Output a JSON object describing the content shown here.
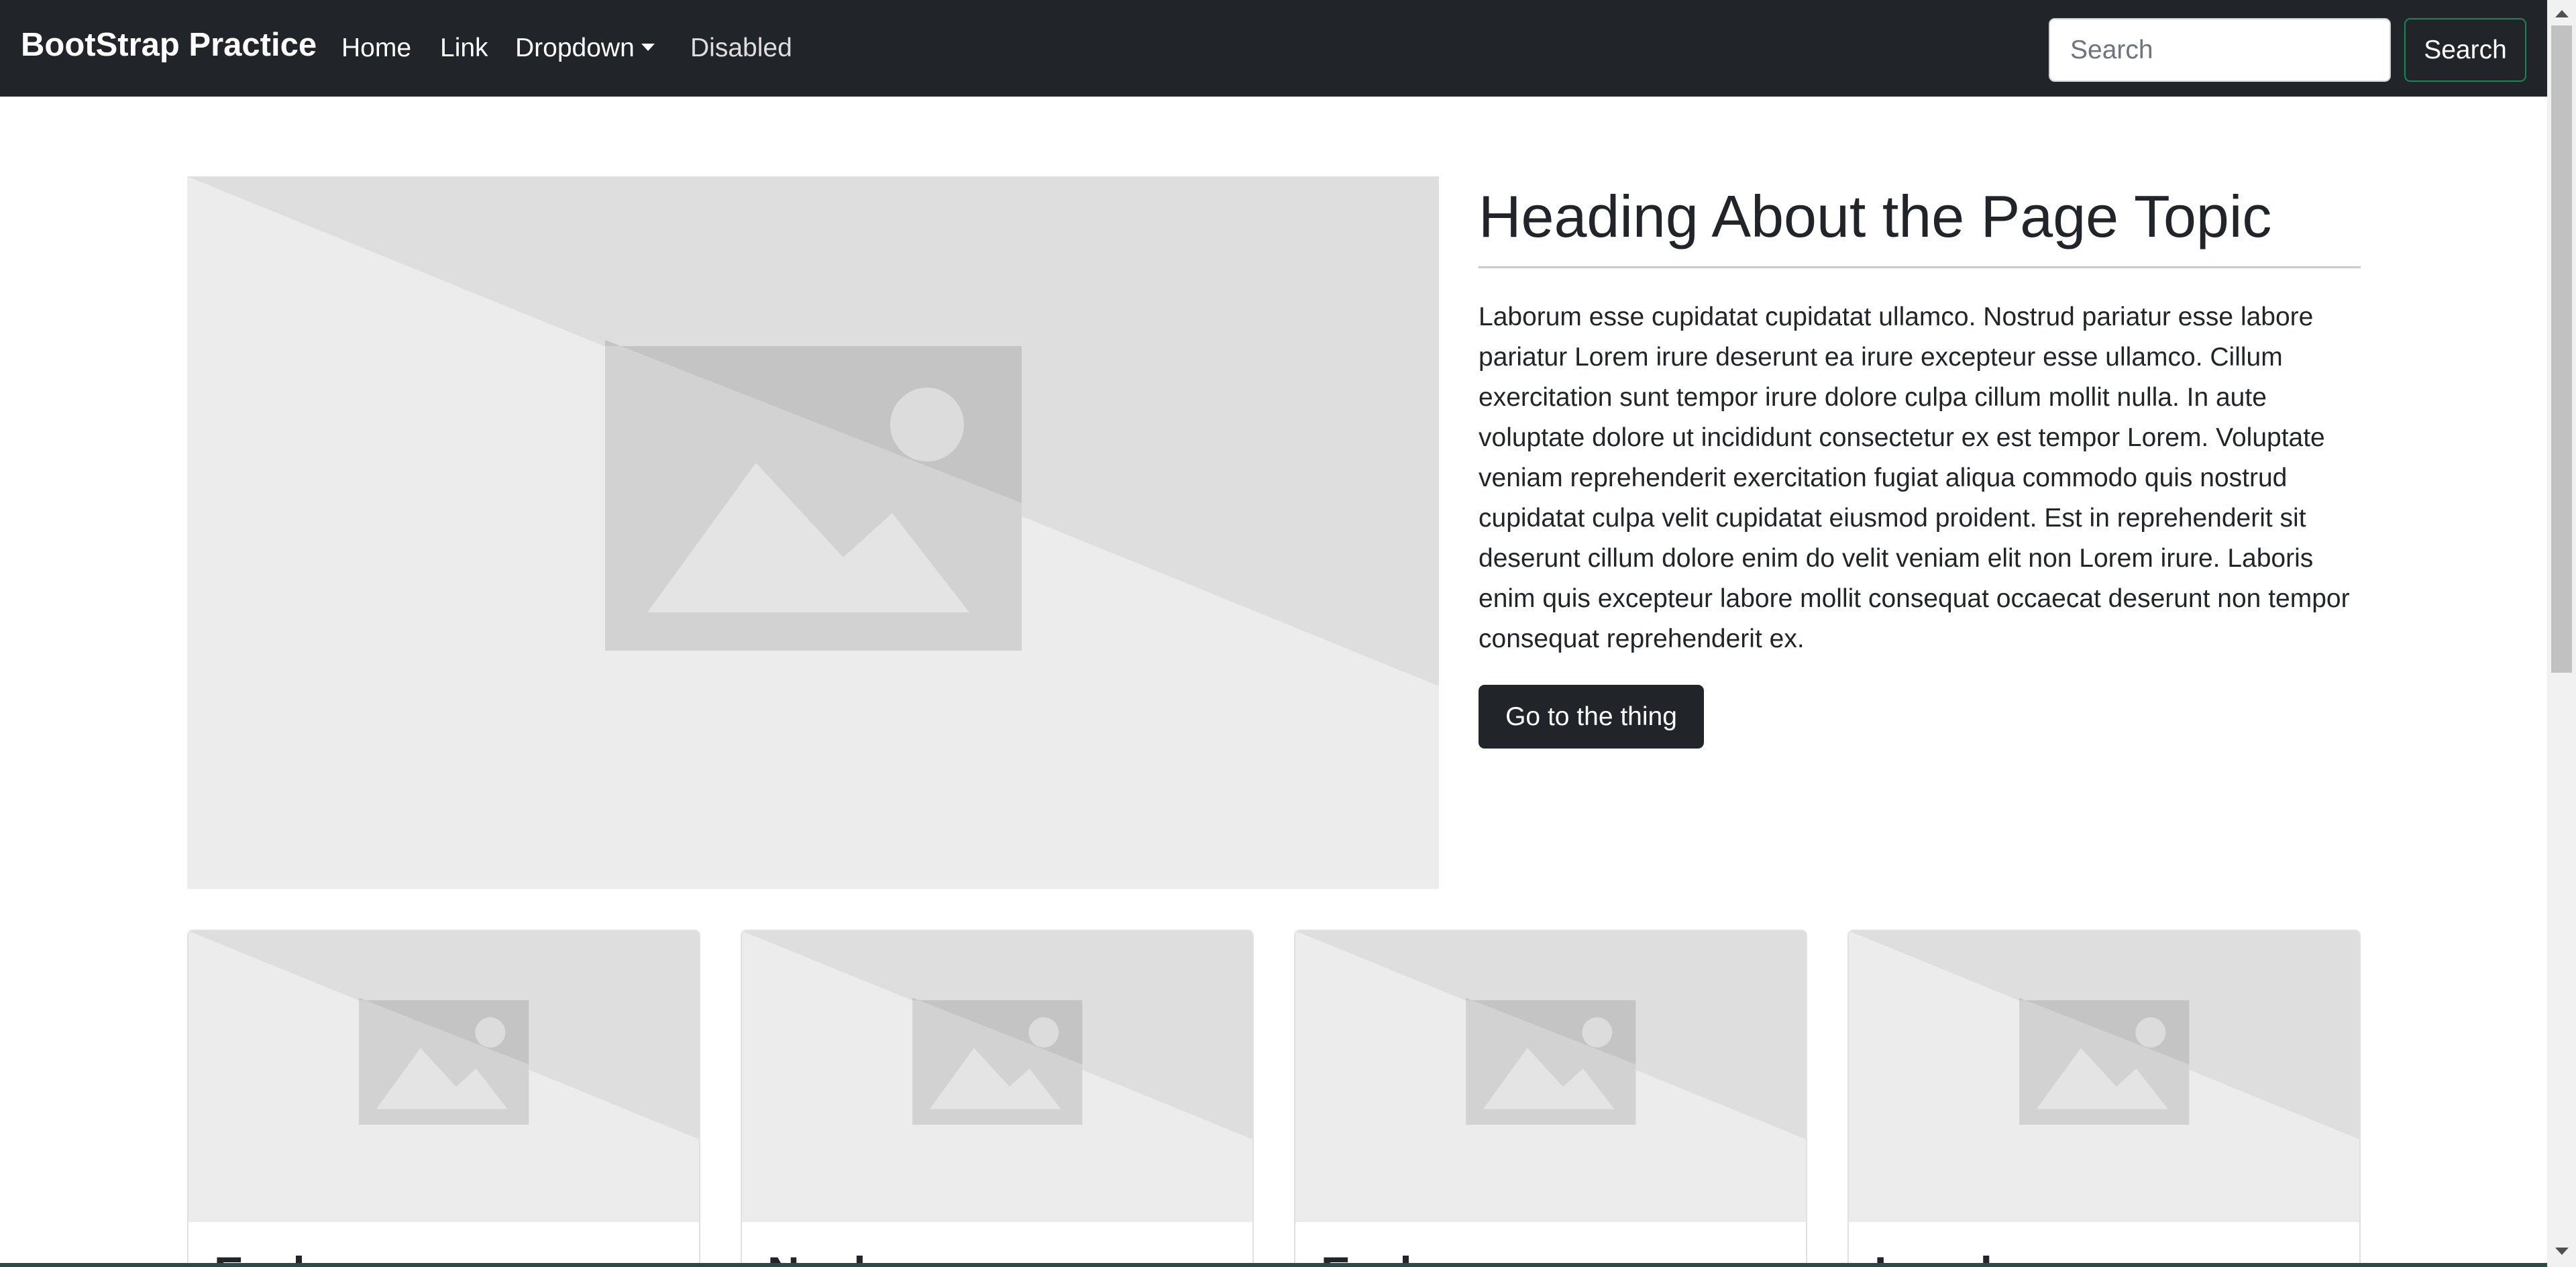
{
  "navbar": {
    "brand": "BootStrap Practice",
    "links": [
      {
        "label": "Home"
      },
      {
        "label": "Link"
      },
      {
        "label": "Dropdown"
      },
      {
        "label": "Disabled"
      }
    ],
    "search": {
      "placeholder": "Search",
      "value": "",
      "button_label": "Search"
    },
    "colors": {
      "background": "#212529",
      "search_outline": "#198754"
    }
  },
  "hero": {
    "image_icon": "image-placeholder-icon",
    "heading": "Heading About the Page Topic",
    "text": "Laborum esse cupidatat cupidatat ullamco. Nostrud pariatur esse labore pariatur Lorem irure deserunt ea irure excepteur esse ullamco. Cillum exercitation sunt tempor irure dolore culpa cillum mollit nulla. In aute voluptate dolore ut incididunt consectetur ex est tempor Lorem. Voluptate veniam reprehenderit exercitation fugiat aliqua commodo quis nostrud cupidatat culpa velit cupidatat eiusmod proident. Est in reprehenderit sit deserunt cillum dolore enim do velit veniam elit non Lorem irure. Laboris enim quis excepteur labore mollit consequat occaecat deserunt non tempor consequat reprehenderit ex.",
    "button_label": "Go to the thing"
  },
  "cards": [
    {
      "title": "Esslog",
      "image_icon": "image-placeholder-icon"
    },
    {
      "title": "Nonlog",
      "image_icon": "image-placeholder-icon"
    },
    {
      "title": "Esslog",
      "image_icon": "image-placeholder-icon"
    },
    {
      "title": "Logslog",
      "image_icon": "image-placeholder-icon"
    }
  ]
}
